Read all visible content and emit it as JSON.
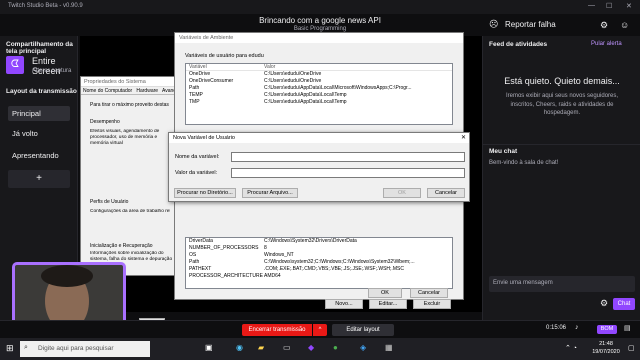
{
  "app": {
    "title": "Twitch Studio Beta - v0.90.9"
  },
  "stream": {
    "title": "Brincando com a google news API",
    "category": "Basic Programming",
    "report_label": "Reportar falha"
  },
  "left": {
    "screen_share_title": "Compartilhamento da tela principal",
    "source_name": "Entire Screen",
    "source_sub": "Alterar captura",
    "layout_title": "Layout da transmissão",
    "scenes": [
      "Principal",
      "Já volto",
      "Apresentando"
    ],
    "add_symbol": "+"
  },
  "right": {
    "activity_title": "Feed de atividades",
    "skip_alerts": "Pular alerta",
    "quiet_title": "Está quieto. Quieto demais...",
    "quiet_body": "Iremos exibir aqui seus novos seguidores, inscritos, Cheers, raids e atividades de hospedagem.",
    "chat_title": "Meu chat",
    "chat_welcome": "Bem-vindo à sala de chat!",
    "chat_placeholder": "Envie uma mensagem",
    "chat_button": "Chat"
  },
  "bottom": {
    "end_stream": "Encerrar transmissão",
    "edit_layout": "Editar layout",
    "timer": "0:15:06",
    "status": "BOM"
  },
  "taskbar": {
    "search_placeholder": "Digite aqui para pesquisar",
    "time": "21:48",
    "date": "19/07/2020"
  },
  "sysprops": {
    "title": "Propriedades do Sistema",
    "tabs": [
      "Nome do Computador",
      "Hardware",
      "Avançado"
    ],
    "admin_note": "Para tirar o máximo proveito destas alterações, faça logon como administrador.",
    "perf_title": "Desempenho",
    "perf_desc": "Efeitos visuais, agendamento de processador, uso de memória e memória virtual",
    "profile_title": "Perfis de Usuário",
    "profile_desc": "Configurações da área de trabalho relativas ao logon",
    "startup_title": "Inicialização e Recuperação",
    "startup_desc": "Informações sobre inicialização do sistema, falha do sistema e depuração",
    "ok": "OK"
  },
  "envvars": {
    "title": "Variáveis de Ambiente",
    "user_section": "Variáveis de usuário para edudu",
    "col_var": "Variável",
    "col_val": "Valor",
    "user_rows": [
      [
        "OneDrive",
        "C:\\Users\\edudu\\OneDrive"
      ],
      [
        "OneDriveConsumer",
        "C:\\Users\\edudu\\OneDrive"
      ],
      [
        "Path",
        "C:\\Users\\edudu\\AppData\\Local\\Microsoft\\WindowsApps;C:\\Progr..."
      ],
      [
        "TEMP",
        "C:\\Users\\edudu\\AppData\\Local\\Temp"
      ],
      [
        "TMP",
        "C:\\Users\\edudu\\AppData\\Local\\Temp"
      ]
    ],
    "sys_rows": [
      [
        "DriverData",
        "C:\\Windows\\System32\\Drivers\\DriverData"
      ],
      [
        "NUMBER_OF_PROCESSORS",
        "8"
      ],
      [
        "OS",
        "Windows_NT"
      ],
      [
        "Path",
        "C:\\Windows\\system32;C:\\Windows;C:\\Windows\\System32\\Wbem;..."
      ],
      [
        "PATHEXT",
        ".COM;.EXE;.BAT;.CMD;.VBS;.VBE;.JS;.JSE;.WSF;.WSH;.MSC"
      ],
      [
        "PROCESSOR_ARCHITECTURE",
        "AMD64"
      ]
    ],
    "new_btn": "Novo...",
    "edit_btn": "Editar...",
    "delete_btn": "Excluir",
    "ok": "OK",
    "cancel": "Cancelar"
  },
  "newvar": {
    "title": "Nova Variável de Usuário",
    "name_label": "Nome da variável:",
    "value_label": "Valor da variável:",
    "name_value": "",
    "value_value": "",
    "browse_dir": "Procurar no Diretório...",
    "browse_file": "Procurar Arquivo...",
    "ok": "OK",
    "cancel": "Cancelar"
  },
  "colors": {
    "twitch_purple": "#9147ff",
    "end_red": "#e91916",
    "cam_border": "#a970ff"
  }
}
